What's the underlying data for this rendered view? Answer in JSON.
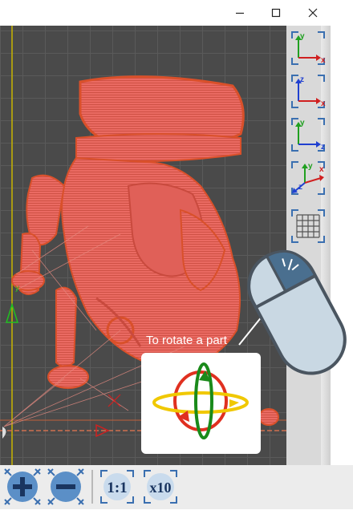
{
  "window": {
    "minimize_icon": "minimize-icon",
    "maximize_icon": "maximize-icon",
    "close_icon": "close-icon"
  },
  "view_buttons": [
    {
      "name": "view-front-xy",
      "axes": [
        "y",
        "x"
      ]
    },
    {
      "name": "view-top-xz",
      "axes": [
        "z",
        "x"
      ]
    },
    {
      "name": "view-side-yz",
      "axes": [
        "y",
        "z"
      ]
    },
    {
      "name": "view-iso-xyz",
      "axes": [
        "y",
        "x",
        "z"
      ]
    },
    {
      "name": "grid-toggle",
      "icon": "grid-icon"
    }
  ],
  "toolbar": {
    "zoom_in_icon": "plus-icon",
    "zoom_out_icon": "minus-icon",
    "scale_1_label": "1:1",
    "scale_10_label": "x10"
  },
  "hint": {
    "label": "To rotate a part"
  },
  "colors": {
    "model": "#e8605a",
    "model_edge": "#d9502a",
    "viewport_bg": "#4a4a4a",
    "grid": "#5a5a5a",
    "axis_x": "#e02020",
    "axis_y": "#20b020",
    "axis_z": "#2040d0",
    "toolbar_blue": "#5b8fc7",
    "mouse_body": "#c9d8e3",
    "mouse_button": "#4a6f8f"
  }
}
